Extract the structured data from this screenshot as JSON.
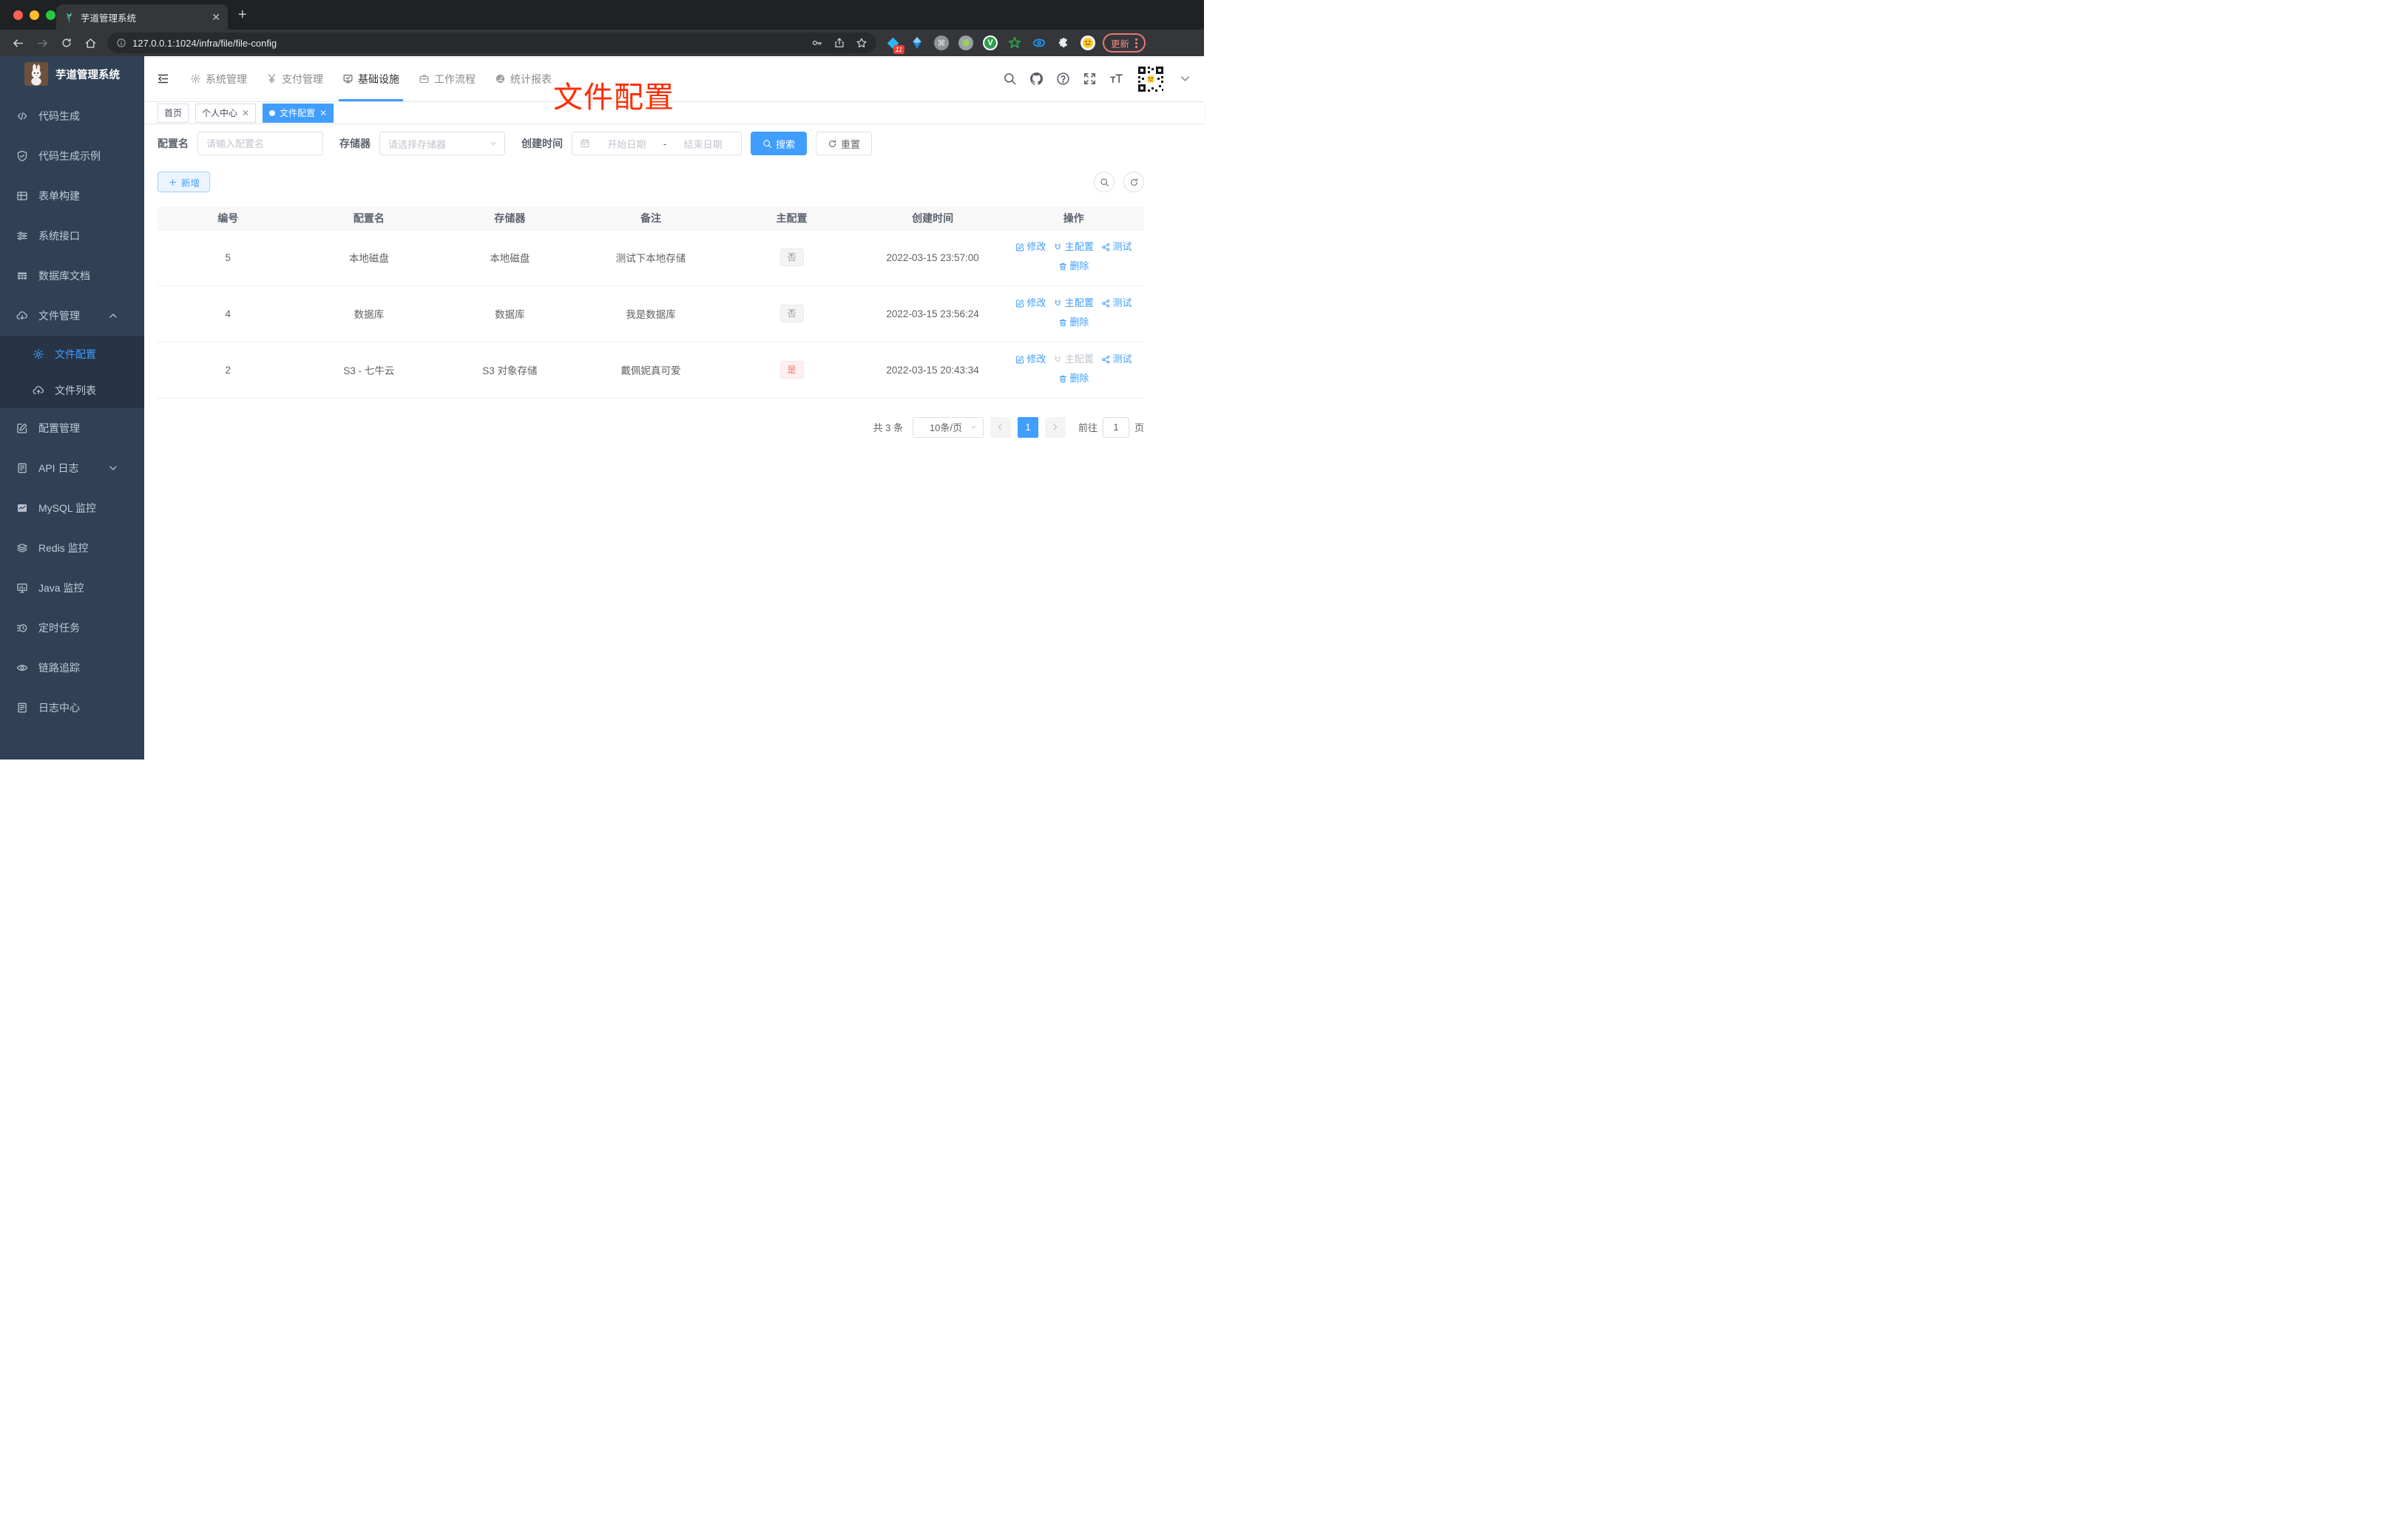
{
  "browser": {
    "tab_title": "芋道管理系统",
    "url": "127.0.0.1:1024/infra/file/file-config",
    "update_label": "更新",
    "extension_badge": "11",
    "extension_v_label": "V"
  },
  "colors": {
    "accent": "#409eff",
    "danger": "#f56c6c",
    "info_tag_text": "#909399",
    "annotation_red": "#ff2b00",
    "sidebar_bg": "#304156",
    "submenu_bg": "#263445"
  },
  "sidebar": {
    "logo_title": "芋道管理系统",
    "items": [
      {
        "label": "代码生成",
        "icon": "code-icon"
      },
      {
        "label": "代码生成示例",
        "icon": "shield-check-icon"
      },
      {
        "label": "表单构建",
        "icon": "form-grid-icon"
      },
      {
        "label": "系统接口",
        "icon": "sliders-icon"
      },
      {
        "label": "数据库文档",
        "icon": "table-filled-icon"
      },
      {
        "label": "文件管理",
        "icon": "cloud-download-icon",
        "state": "expanded"
      },
      {
        "label": "文件配置",
        "icon": "gear-icon",
        "state": "active-sub"
      },
      {
        "label": "文件列表",
        "icon": "cloud-upload-icon",
        "state": "sub"
      },
      {
        "label": "配置管理",
        "icon": "edit-square-icon"
      },
      {
        "label": "API 日志",
        "icon": "log-doc-icon",
        "state": "collapsed"
      },
      {
        "label": "MySQL 监控",
        "icon": "chart-filled-icon"
      },
      {
        "label": "Redis 监控",
        "icon": "layers-icon"
      },
      {
        "label": "Java 监控",
        "icon": "monitor-icon"
      },
      {
        "label": "定时任务",
        "icon": "timer-icon"
      },
      {
        "label": "链路追踪",
        "icon": "eye-icon"
      },
      {
        "label": "日志中心",
        "icon": "log-doc-icon"
      }
    ]
  },
  "topnav": {
    "items": [
      {
        "label": "系统管理",
        "icon": "gear-icon"
      },
      {
        "label": "支付管理",
        "icon": "yen-icon"
      },
      {
        "label": "基础设施",
        "icon": "monitor-check-icon",
        "active": true
      },
      {
        "label": "工作流程",
        "icon": "briefcase-icon"
      },
      {
        "label": "统计报表",
        "icon": "dashboard-icon"
      }
    ]
  },
  "tags": {
    "items": [
      {
        "label": "首页"
      },
      {
        "label": "个人中心",
        "closable": true
      },
      {
        "label": "文件配置",
        "closable": true,
        "active": true
      }
    ]
  },
  "annotation": {
    "text": "文件配置"
  },
  "filters": {
    "name_label": "配置名",
    "name_placeholder": "请输入配置名",
    "storage_label": "存储器",
    "storage_placeholder": "请选择存储器",
    "time_label": "创建时间",
    "start_placeholder": "开始日期",
    "range_separator": "-",
    "end_placeholder": "结束日期",
    "search_label": "搜索",
    "reset_label": "重置"
  },
  "toolbar": {
    "add_label": "新增"
  },
  "table": {
    "columns": [
      "编号",
      "配置名",
      "存储器",
      "备注",
      "主配置",
      "创建时间",
      "操作"
    ],
    "actions": {
      "edit": "修改",
      "master": "主配置",
      "test": "测试",
      "delete": "删除"
    },
    "rows": [
      {
        "id": "5",
        "name": "本地磁盘",
        "storage": "本地磁盘",
        "remark": "测试下本地存储",
        "master": "否",
        "created": "2022-03-15 23:57:00",
        "master_action_disabled": false
      },
      {
        "id": "4",
        "name": "数据库",
        "storage": "数据库",
        "remark": "我是数据库",
        "master": "否",
        "created": "2022-03-15 23:56:24",
        "master_action_disabled": false
      },
      {
        "id": "2",
        "name": "S3 - 七牛云",
        "storage": "S3 对象存储",
        "remark": "戴佩妮真可爱",
        "master": "是",
        "created": "2022-03-15 20:43:34",
        "master_action_disabled": true
      }
    ]
  },
  "pagination": {
    "total_label": "共 3 条",
    "page_size_label": "10条/页",
    "current_page": "1",
    "goto_label": "前往",
    "goto_value": "1",
    "page_unit_label": "页"
  }
}
